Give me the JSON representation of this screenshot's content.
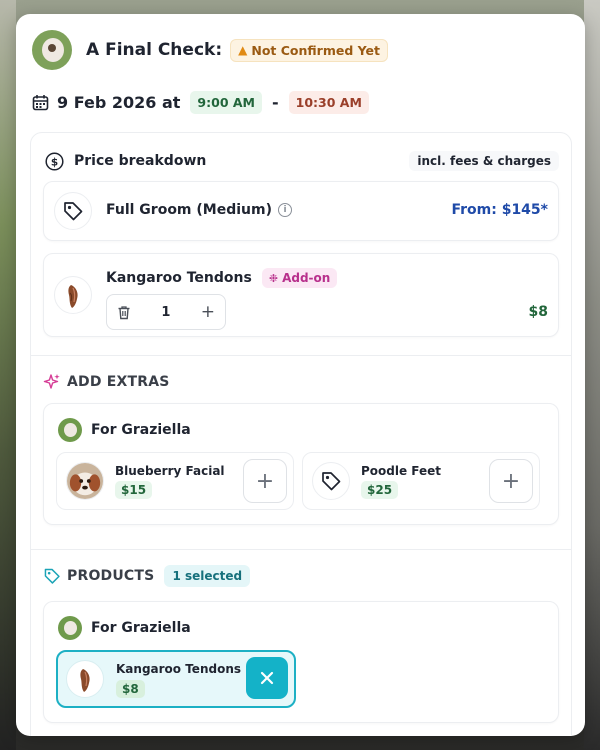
{
  "header": {
    "title": "A Final Check:",
    "status_badge": "Not Confirmed Yet",
    "status_icon": "warning-icon"
  },
  "schedule": {
    "date": "9 Feb 2026",
    "at_label": "at",
    "start_time": "9:00 AM",
    "separator": "-",
    "end_time": "10:30 AM"
  },
  "price_breakdown": {
    "title": "Price breakdown",
    "note": "incl. fees & charges",
    "service": {
      "name": "Full Groom (Medium)",
      "price": "From: $145*",
      "icon": "tag-icon"
    },
    "addon": {
      "name": "Kangaroo Tendons",
      "badge": "Add-on",
      "quantity": "1",
      "price": "$8"
    }
  },
  "extras": {
    "title": "ADD EXTRAS",
    "for_label": "For Graziella",
    "items": [
      {
        "name": "Blueberry Facial",
        "price": "$15",
        "icon": "dog-photo"
      },
      {
        "name": "Poodle Feet",
        "price": "$25",
        "icon": "tag-icon"
      }
    ]
  },
  "products": {
    "title": "PRODUCTS",
    "count": "1 selected",
    "for_label": "For Graziella",
    "selected": {
      "name": "Kangaroo Tendons",
      "price": "$8"
    }
  },
  "colors": {
    "accent_blue": "#1f4aa8",
    "price_green": "#22663b",
    "teal": "#14b2c8",
    "warning": "#e08a14",
    "addon_pink": "#b8308c"
  }
}
